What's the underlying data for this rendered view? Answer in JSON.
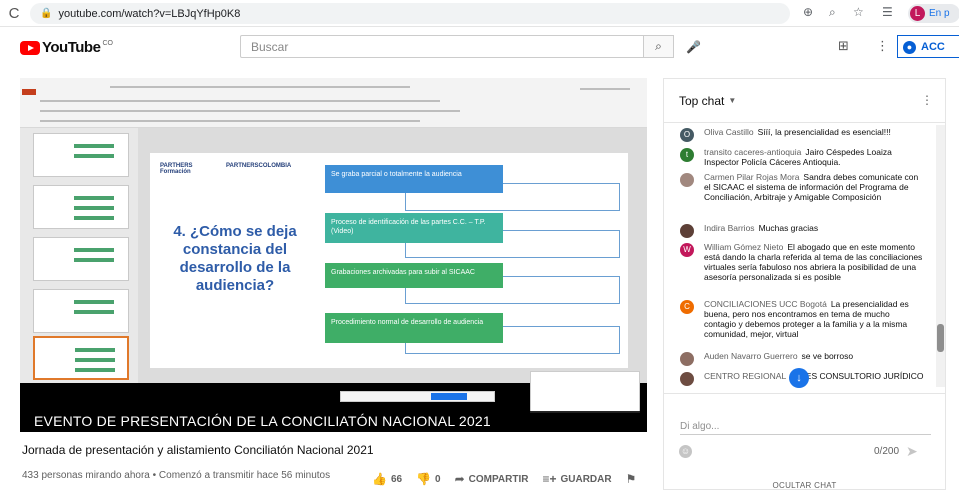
{
  "browser": {
    "url": "youtube.com/watch?v=LBJqYfHp0K8",
    "profile_label": "En p",
    "profile_initial": "L"
  },
  "youtube": {
    "logo_text": "YouTube",
    "logo_badge": "CO",
    "search_placeholder": "Buscar",
    "signin_label": "ACC"
  },
  "video": {
    "slide_title": "4. ¿Cómo se deja constancia del desarrollo de la audiencia?",
    "logo1": "PARTHERS Formación",
    "logo2": "PARTNERSCOLOMBIA",
    "boxes": [
      "Se graba parcial o totalmente la audiencia",
      "Proceso de identificación de las partes C.C. – T.P. (Video)",
      "Grabaciones archivadas para subir al SICAAC",
      "Procedimiento normal de desarrollo de audiencia"
    ],
    "banner": "EVENTO DE PRESENTACIÓN DE LA CONCILIATÓN NACIONAL 2021"
  },
  "info": {
    "title": "Jornada de presentación y alistamiento Conciliatón Nacional 2021",
    "meta": "433 personas mirando ahora • Comenzó a transmitir hace 56 minutos",
    "likes": "66",
    "dislikes": "0",
    "share": "COMPARTIR",
    "save": "GUARDAR"
  },
  "chat": {
    "header": "Top chat",
    "messages": [
      {
        "initial": "O",
        "color": "#455a64",
        "author": "Oliva Castillo",
        "text": "Sííí, la presencialidad es esencial!!!"
      },
      {
        "initial": "t",
        "color": "#2e7d32",
        "author": "transito caceres-antioquia",
        "text": "Jairo Céspedes Loaiza Inspector Policía Cáceres Antioquia."
      },
      {
        "initial": "",
        "color": "#a1887f",
        "author": "Carmen Pilar Rojas Mora",
        "text": "Sandra debes comunicate con el SICAAC el sistema de información del Programa de Conciliación, Arbitraje y Amigable Composición"
      },
      {
        "initial": "",
        "color": "#5d4037",
        "author": "Indira Barrios",
        "text": "Muchas gracias"
      },
      {
        "initial": "W",
        "color": "#c2185b",
        "author": "William Gómez Nieto",
        "text": "El abogado que en este momento está dando la charla referida al tema de las conciliaciones virtuales sería fabuloso nos abriera la posibilidad de una asesoría personalizada si es posible"
      },
      {
        "initial": "C",
        "color": "#ef6c00",
        "author": "CONCILIACIONES UCC Bogotá",
        "text": "La presencialidad es buena, pero nos encontramos en tema de mucho contagio y debemos proteger a la familia y a la misma comunidad, mejor, virtual"
      },
      {
        "initial": "",
        "color": "#8d6e63",
        "author": "Auden Navarro Guerrero",
        "text": "se ve borroso"
      },
      {
        "initial": "",
        "color": "#6d4c41",
        "author": "CENTRO REGIONAL",
        "text": "ZALES CONSULTORIO JURÍDICO"
      }
    ],
    "input_placeholder": "Di algo...",
    "char_count": "0/200",
    "hide_label": "OCULTAR CHAT"
  }
}
